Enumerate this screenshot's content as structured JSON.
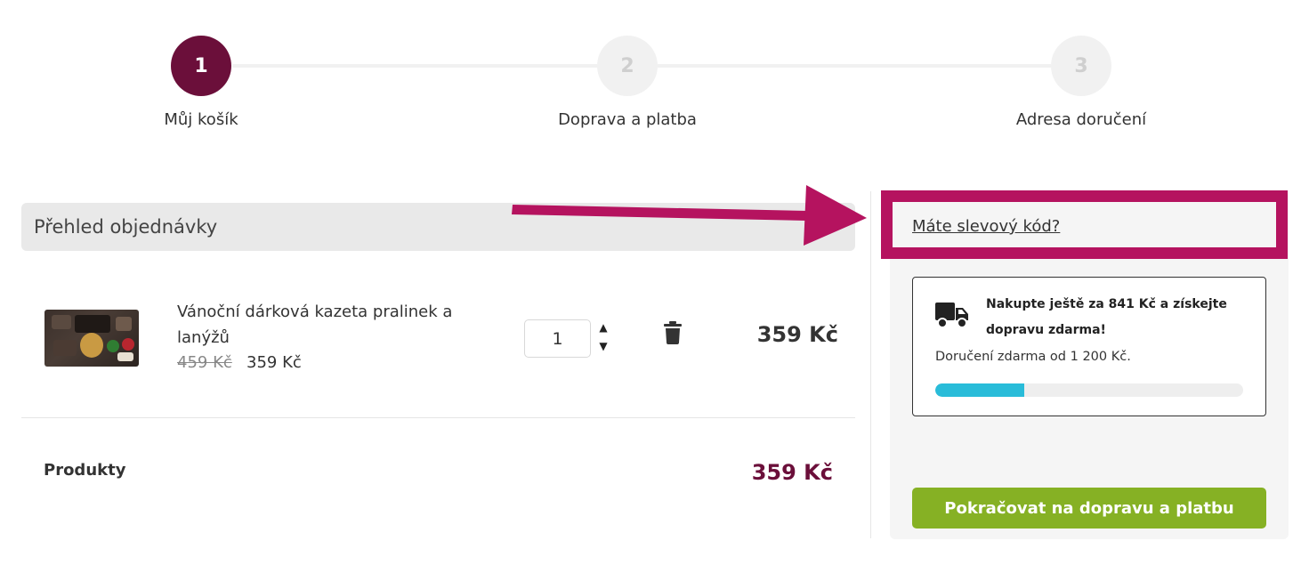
{
  "stepper": {
    "steps": [
      {
        "number": "1",
        "label": "Můj košík",
        "state": "active"
      },
      {
        "number": "2",
        "label": "Doprava a platba",
        "state": "inactive"
      },
      {
        "number": "3",
        "label": "Adresa doručení",
        "state": "inactive"
      }
    ]
  },
  "overview": {
    "title": "Přehled objednávky"
  },
  "cart": {
    "items": [
      {
        "name": "Vánoční dárková kazeta pralinek a lanýžů",
        "old_price": "459 Kč",
        "price": "359 Kč",
        "quantity": "1",
        "total": "359 Kč"
      }
    ],
    "products_label": "Produkty",
    "products_total": "359 Kč"
  },
  "sidebar": {
    "coupon_link": "Máte slevový kód?",
    "shipping": {
      "headline": "Nakupte ještě za 841 Kč a získejte dopravu zdarma!",
      "note": "Doručení zdarma od 1 200 Kč.",
      "progress": 0.29
    },
    "continue_label": "Pokračovat na dopravu a platbu"
  },
  "colors": {
    "brand": "#6b0f3a",
    "highlight": "#b5135f",
    "success": "#86b124",
    "progress": "#29bcd9"
  }
}
